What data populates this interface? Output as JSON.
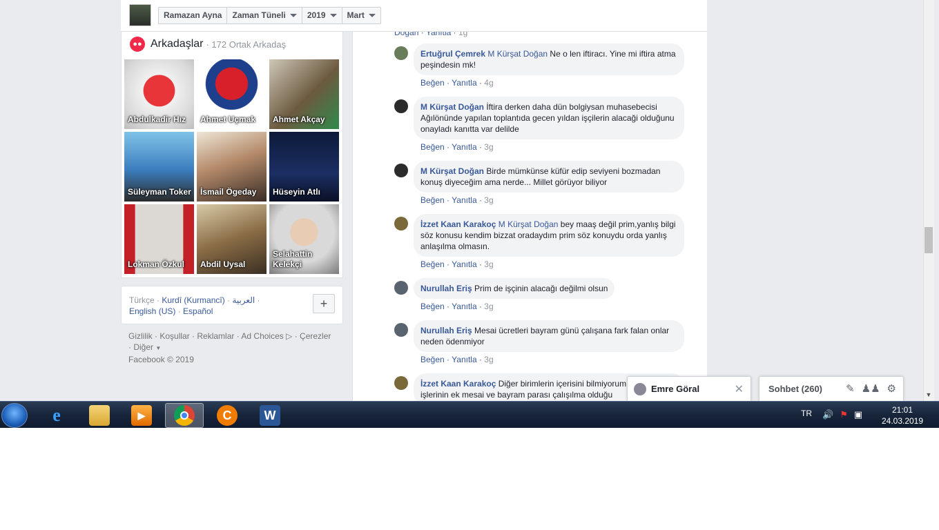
{
  "header": {
    "breadcrumbs": [
      {
        "label": "Ramazan Ayna",
        "dropdown": false
      },
      {
        "label": "Zaman Tüneli",
        "dropdown": true
      },
      {
        "label": "2019",
        "dropdown": true
      },
      {
        "label": "Mart",
        "dropdown": true
      }
    ]
  },
  "friends": {
    "title": "Arkadaşlar",
    "count": "· 172 Ortak Arkadaş",
    "items": [
      {
        "name": "Abdulkadir Hız"
      },
      {
        "name": "Ahmet Uçmak"
      },
      {
        "name": "Ahmet Akçay"
      },
      {
        "name": "Süleyman Toker"
      },
      {
        "name": "İsmail Ögeday"
      },
      {
        "name": "Hüseyin Atlı"
      },
      {
        "name": "Lokman Özkul"
      },
      {
        "name": "Abdil Uysal"
      },
      {
        "name": "Selahattin Kelekçi"
      }
    ]
  },
  "languages": {
    "line1": [
      "Türkçe",
      "Kurdî (Kurmancî)",
      "العربية"
    ],
    "line2": [
      "English (US)",
      "Español"
    ],
    "more_label": "+"
  },
  "footer": {
    "links": [
      "Gizlilik",
      "Koşullar",
      "Reklamlar",
      "Ad Choices",
      "Çerezler",
      "Diğer"
    ],
    "copyright": "Facebook © 2019"
  },
  "comments": [
    {
      "author": "Ertuğrul Çemrek",
      "mention": "M Kürşat Doğan",
      "text": " Ne o len iftiracı. Yine mi iftira atma peşindesin mk!",
      "like": "Beğen",
      "reply": "Yanıtla",
      "time": "4g"
    },
    {
      "author": "M Kürşat Doğan",
      "mention": "",
      "text": " İftira derken daha dün bolgiysan muhasebecisi Ağılönünde yapılan toplantıda gecen yıldan işçilerin alacaği olduğunu onayladı kanıtta var delilde",
      "like": "Beğen",
      "reply": "Yanıtla",
      "time": "3g"
    },
    {
      "author": "M Kürşat Doğan",
      "mention": "",
      "text": " Birde mümkünse küfür edip seviyeni bozmadan konuş diyeceğim ama nerde... Millet görüyor biliyor",
      "like": "Beğen",
      "reply": "Yanıtla",
      "time": "3g"
    },
    {
      "author": "İzzet Kaan Karakoç",
      "mention": "M Kürşat Doğan",
      "text": " bey maaş değil prim,yanlış bilgi söz konusu kendim bizzat oradaydım prim söz konuydu orda yanlış anlaşılma olmasın.",
      "like": "Beğen",
      "reply": "Yanıtla",
      "time": "3g"
    },
    {
      "author": "Nurullah Eriş",
      "mention": "",
      "text": " Prim de işçinin alacağı değilmi olsun",
      "like": "Beğen",
      "reply": "Yanıtla",
      "time": "3g"
    },
    {
      "author": "Nurullah Eriş",
      "mention": "",
      "text": " Mesai ücretleri bayram günü çalışana fark falan onlar neden ödenmiyor",
      "like": "Beğen",
      "reply": "Yanıtla",
      "time": "3g"
    },
    {
      "author": "İzzet Kaan Karakoç",
      "mention": "",
      "text": " Diğer birimlerin içerisini bilmiyorum ama Su işlerinin ek mesai ve bayram parası çalışılma olduğu",
      "like": "",
      "reply": "",
      "time": ""
    }
  ],
  "top_partial": {
    "name": "Doğan",
    "reply": "Yanıtla",
    "time": "1g"
  },
  "chat": {
    "open_chat_name": "Emre Göral",
    "sidebar_title": "Sohbet (260)"
  },
  "taskbar": {
    "apps": [
      "internet-explorer",
      "file-explorer",
      "media-player",
      "chrome",
      "ccleaner",
      "word"
    ],
    "active": "chrome"
  },
  "tray": {
    "lang": "TR",
    "time": "21:01",
    "date": "24.03.2019"
  }
}
